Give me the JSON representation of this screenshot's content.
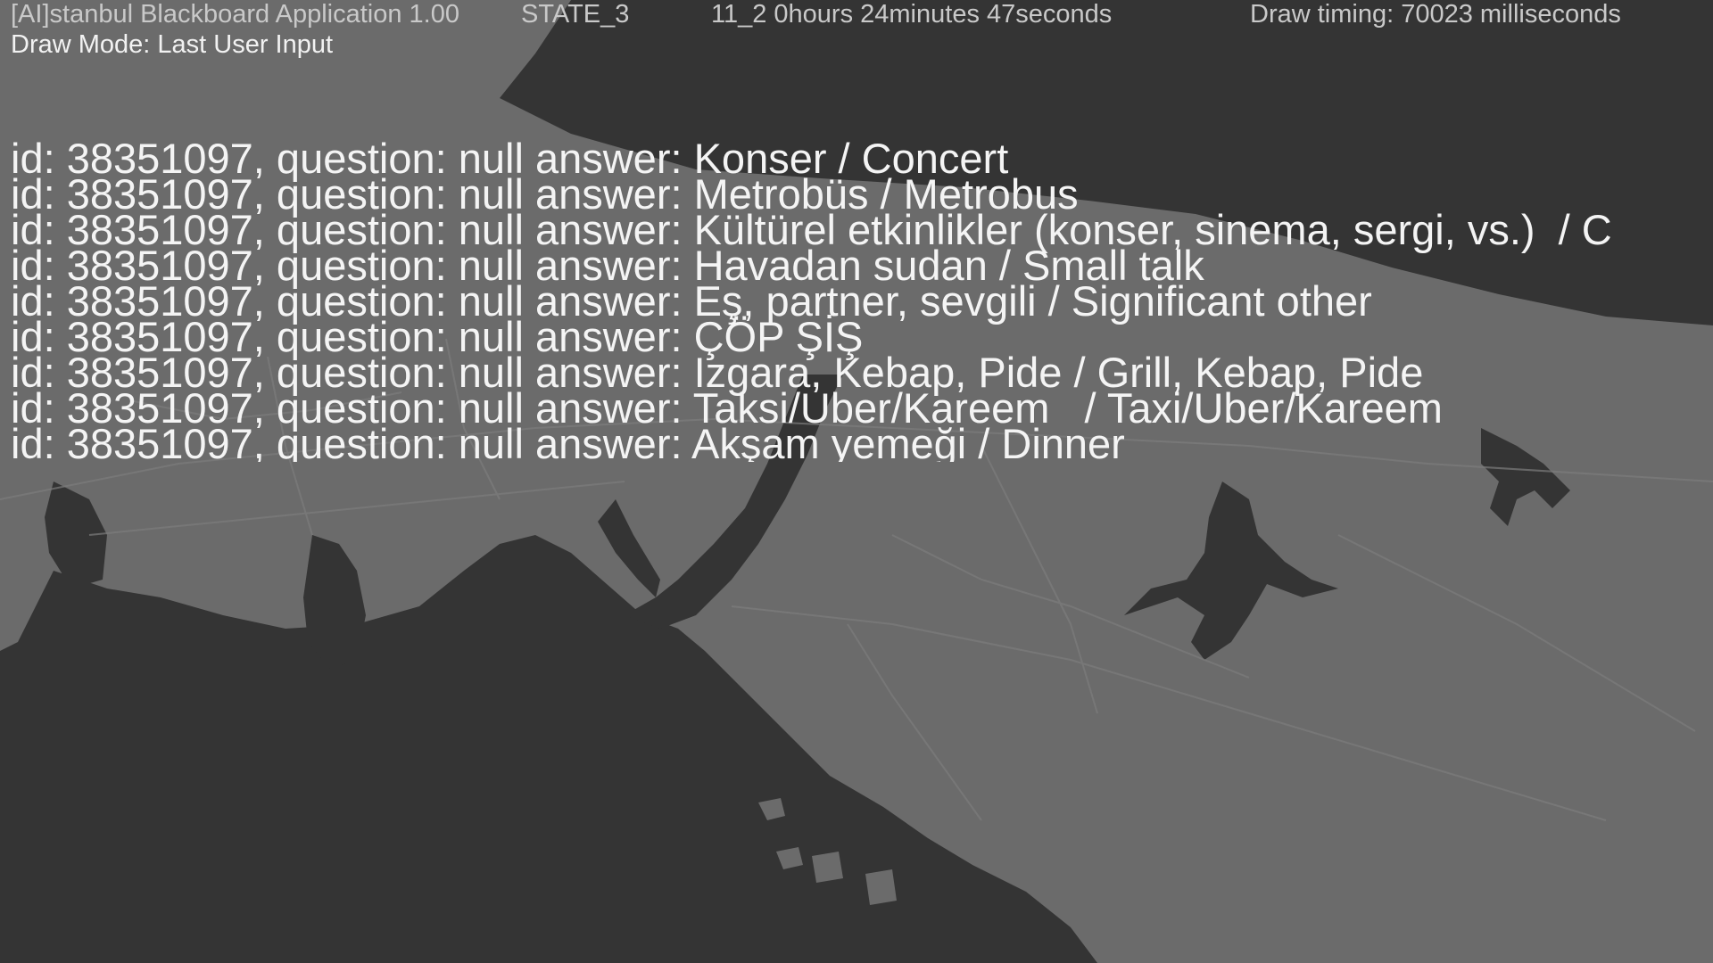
{
  "window": {
    "app_title": "[AI]stanbul Blackboard Application 1.00",
    "state": "STATE_3",
    "timer": "11_2  0hours 24minutes 47seconds",
    "draw_timing": "Draw timing: 70023 milliseconds",
    "draw_mode": "Draw Mode: Last User Input"
  },
  "answers": [
    "id: 38351097, question: null answer: Konser / Concert",
    "id: 38351097, question: null answer: Metrobüs / Metrobus",
    "id: 38351097, question: null answer: Kültürel etkinlikler (konser, sinema, sergi, vs.)  / C",
    "id: 38351097, question: null answer: Havadan sudan / Small talk",
    "id: 38351097, question: null answer: Eş, partner, sevgili / Significant other",
    "id: 38351097, question: null answer: ÇÖP ŞİŞ",
    "id: 38351097, question: null answer: Izgara, Kebap, Pide / Grill, Kebap, Pide",
    "id: 38351097, question: null answer: Taksi/Uber/Kareem   / Taxi/Uber/Kareem",
    "id: 38351097, question: null answer: Akşam yemeği / Dinner"
  ],
  "map": {
    "land_color": "#6b6b6b",
    "water_color": "#343434",
    "road_color": "#7d7d7d"
  }
}
